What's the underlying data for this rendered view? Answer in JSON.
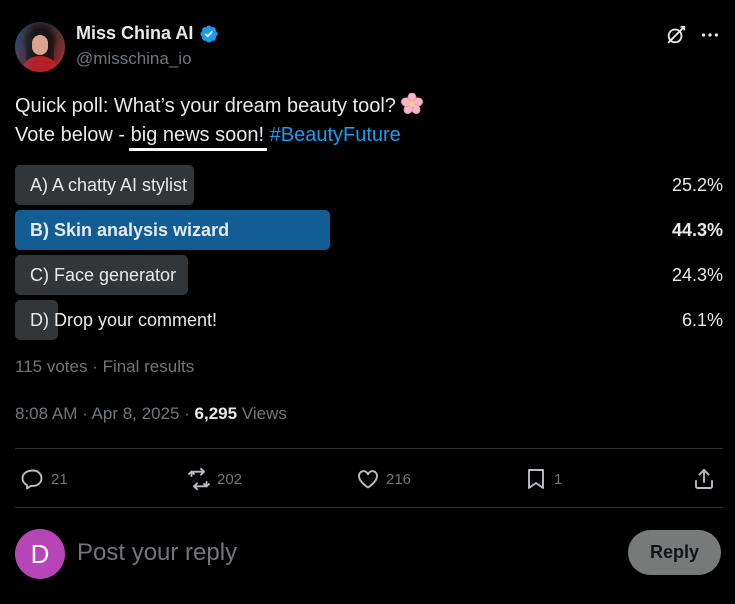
{
  "author": {
    "display_name": "Miss China AI",
    "handle": "@misschina_io",
    "verified": true,
    "avatar_icon": "profile-photo"
  },
  "header_icons": [
    "grok-icon",
    "more-icon"
  ],
  "tweet": {
    "line1": "Quick poll: What’s your dream beauty tool?",
    "line1_emoji": "cherry-blossom-icon",
    "line2_prefix": "Vote below - ",
    "line2_underlined": "big news soon!",
    "line2_space": " ",
    "hashtag": "#BeautyFuture"
  },
  "poll": {
    "options": [
      {
        "label": "A) A chatty AI stylist",
        "percent_text": "25.2%",
        "percent": 25.2,
        "winner": false
      },
      {
        "label": "B) Skin analysis wizard",
        "percent_text": "44.3%",
        "percent": 44.3,
        "winner": true
      },
      {
        "label": "C) Face generator",
        "percent_text": "24.3%",
        "percent": 24.3,
        "winner": false
      },
      {
        "label": "D) Drop your comment!",
        "percent_text": "6.1%",
        "percent": 6.1,
        "winner": false
      }
    ],
    "meta": "115 votes · Final results"
  },
  "timestamp": {
    "time_date": "8:08 AM · Apr 8, 2025 · ",
    "views_count": "6,295",
    "views_label": " Views"
  },
  "actions": {
    "replies": "21",
    "reposts": "202",
    "likes": "216",
    "bookmarks": "1"
  },
  "reply": {
    "avatar_letter": "D",
    "placeholder": "Post your reply",
    "button_label": "Reply"
  },
  "colors": {
    "background": "#000000",
    "accent": "#1d9bf0",
    "winner_bar": "#125d94",
    "bar": "#333639",
    "muted": "#71767b",
    "reply_avatar": "#b845b8"
  }
}
